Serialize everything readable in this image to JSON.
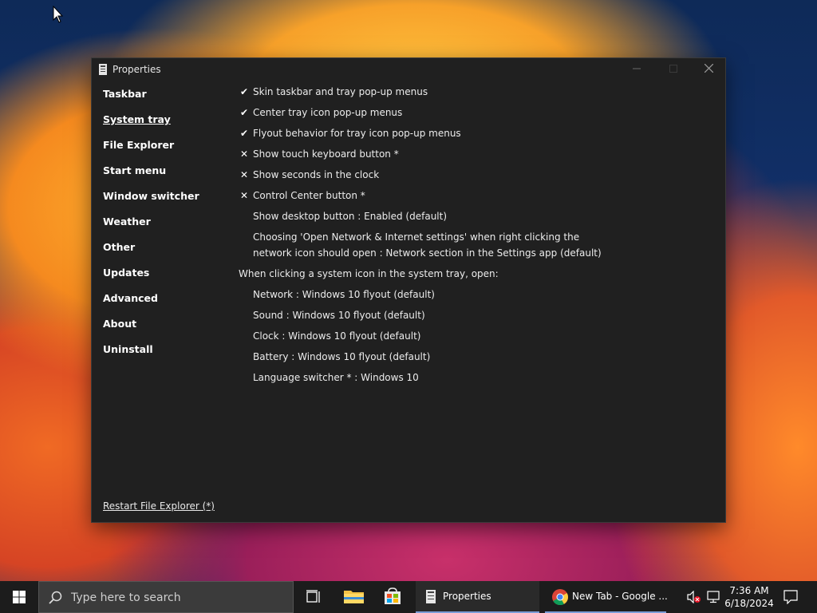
{
  "window": {
    "title": "Properties",
    "minimize_icon": "minimize-icon",
    "maximize_icon": "maximize-icon",
    "close_icon": "close-icon"
  },
  "sidebar": {
    "items": [
      {
        "label": "Taskbar",
        "active": false
      },
      {
        "label": "System tray",
        "active": true
      },
      {
        "label": "File Explorer",
        "active": false
      },
      {
        "label": "Start menu",
        "active": false
      },
      {
        "label": "Window switcher",
        "active": false
      },
      {
        "label": "Weather",
        "active": false
      },
      {
        "label": "Other",
        "active": false
      },
      {
        "label": "Updates",
        "active": false
      },
      {
        "label": "Advanced",
        "active": false
      },
      {
        "label": "About",
        "active": false
      },
      {
        "label": "Uninstall",
        "active": false
      }
    ],
    "restart_link": "Restart File Explorer (*)"
  },
  "options": [
    {
      "mark": "✔",
      "label": "Skin taskbar and tray pop-up menus"
    },
    {
      "mark": "✔",
      "label": "Center tray icon pop-up menus"
    },
    {
      "mark": "✔",
      "label": "Flyout behavior for tray icon pop-up menus"
    },
    {
      "mark": "✕",
      "label": "Show touch keyboard button *"
    },
    {
      "mark": "✕",
      "label": "Show seconds in the clock"
    },
    {
      "mark": "✕",
      "label": "Control Center button *"
    },
    {
      "mark": "",
      "label": "Show desktop button : Enabled (default)"
    },
    {
      "mark": "",
      "label_line1": "Choosing 'Open Network & Internet settings' when right clicking the",
      "label_line2": "network icon should open : Network section in the Settings app (default)"
    }
  ],
  "tray_heading": "When clicking a system icon in the system tray, open:",
  "tray_options": [
    "Network : Windows 10 flyout (default)",
    "Sound : Windows 10 flyout (default)",
    "Clock : Windows 10 flyout (default)",
    "Battery : Windows 10 flyout (default)",
    "Language switcher * : Windows 10"
  ],
  "taskbar": {
    "search_placeholder": "Type here to search",
    "properties_label": "Properties",
    "chrome_label": "New Tab - Google ...",
    "time": "7:36 AM",
    "date": "6/18/2024"
  }
}
